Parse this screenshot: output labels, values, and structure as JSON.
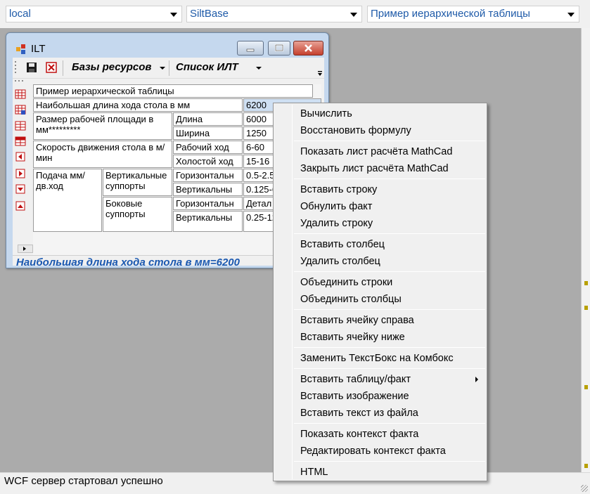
{
  "combos": [
    {
      "name": "server",
      "value": "local"
    },
    {
      "name": "database",
      "value": "SiltBase"
    },
    {
      "name": "table",
      "value": "Пример иерархической таблицы"
    }
  ],
  "window": {
    "title": "ILT"
  },
  "toolbar": {
    "resources_label": "Базы ресурсов",
    "ilt_list_label": "Список ИЛТ"
  },
  "table": {
    "title": "Пример иерархической таблицы",
    "max_stroke_label": "Наибольшая длина хода стола в мм",
    "max_stroke_value": "6200",
    "work_area_label": "Размер рабочей площади в мм*********",
    "length_label": "Длина",
    "length_value": "6000",
    "width_label": "Ширина",
    "width_value": "1250",
    "speed_label": "Скорость движения стола в м/мин",
    "working_stroke_label": "Рабочий ход",
    "working_stroke_value": "6-60",
    "idle_stroke_label": "Холостой ход",
    "idle_stroke_value": "15-16",
    "feed_label": "Подача мм/дв.ход",
    "vertical_supports_label": "Вертикальные суппорты",
    "side_supports_label": "Боковые суппорты",
    "horiz_label_1": "Горизонтальн",
    "horiz_value_1": "0.5-2.5",
    "vert_label_1": "Вертикальны",
    "vert_value_1": "0.125-6",
    "horiz_label_2": "Горизонтальн",
    "horiz_value_2": "Детал",
    "vert_label_2": "Вертикальны",
    "vert_value_2": "0.25-12"
  },
  "formula_text": "Наибольшая длина хода стола в мм=6200",
  "status_text": "WCF сервер стартовал успешно",
  "context_menu": {
    "calculate": "Вычислить",
    "restore_formula": "Восстановить формулу",
    "show_mathcad": "Показать лист расчёта MathCad",
    "close_mathcad": "Закрыть лист расчёта MathCad",
    "insert_row": "Вставить строку",
    "reset_fact": "Обнулить факт",
    "delete_row": "Удалить строку",
    "insert_column": "Вставить столбец",
    "delete_column": "Удалить столбец",
    "merge_rows": "Объединить строки",
    "merge_columns": "Объединить столбцы",
    "insert_cell_right": "Вставить ячейку справа",
    "insert_cell_below": "Вставить ячейку ниже",
    "replace_textbox": "Заменить ТекстБокс на Комбокс",
    "insert_table_fact": "Вставить таблицу/факт",
    "insert_image": "Вставить изображение",
    "insert_text_file": "Вставить текст из файла",
    "show_fact_context": "Показать контекст факта",
    "edit_fact_context": "Редактировать контекст факта",
    "html": "HTML"
  },
  "colors": {
    "combo_text": "#1e5aa8",
    "formula_text": "#1a58b0",
    "desktop": "#ababab"
  }
}
